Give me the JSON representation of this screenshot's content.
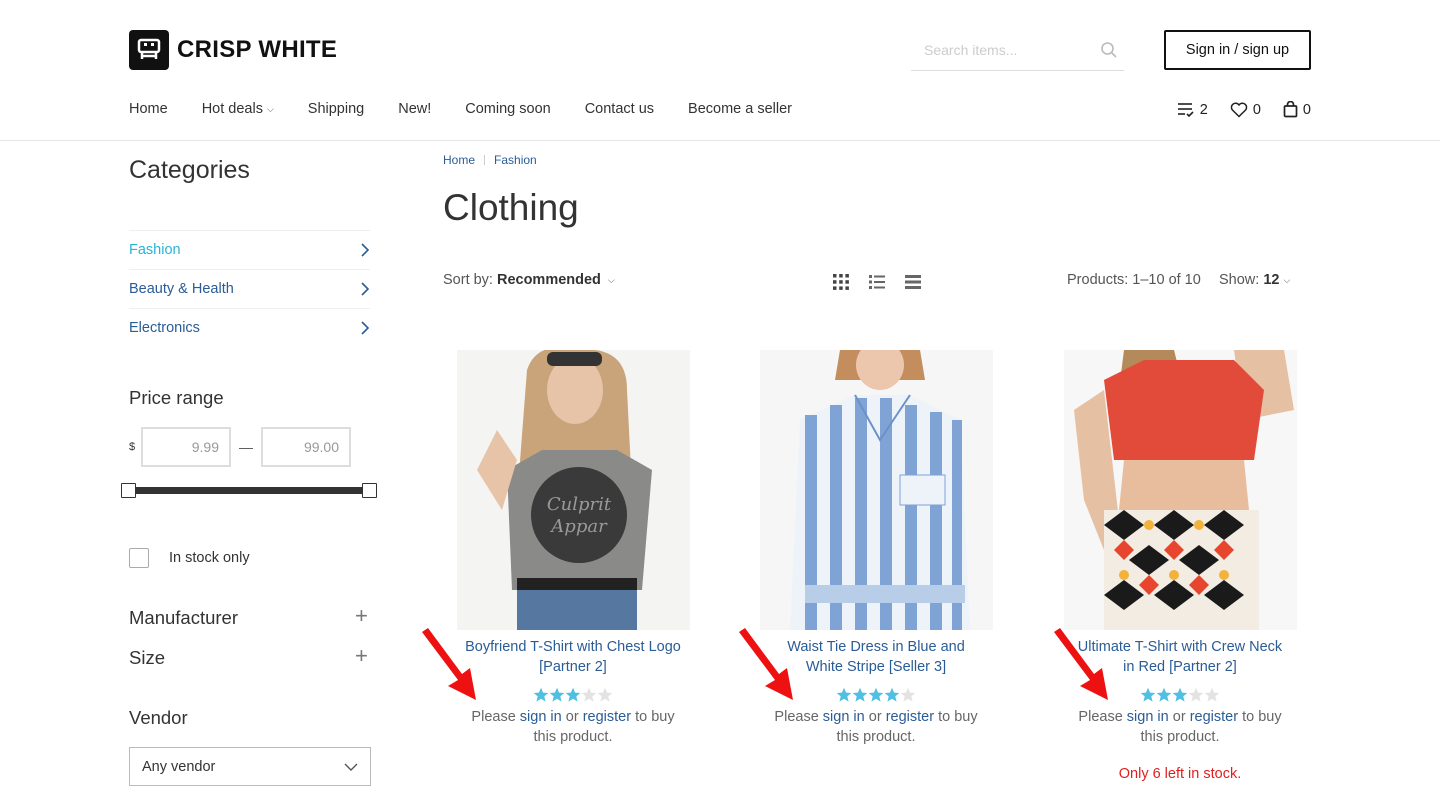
{
  "header": {
    "brand": "CRISP WHITE",
    "search_placeholder": "Search items...",
    "signin_label": "Sign in / sign up",
    "wishlist_count": "2",
    "favorites_count": "0",
    "cart_count": "0"
  },
  "nav": [
    {
      "label": "Home"
    },
    {
      "label": "Hot deals"
    },
    {
      "label": "Shipping"
    },
    {
      "label": "New!"
    },
    {
      "label": "Coming soon"
    },
    {
      "label": "Contact us"
    },
    {
      "label": "Become a seller"
    }
  ],
  "sidebar": {
    "title": "Categories",
    "categories": [
      {
        "label": "Fashion",
        "active": true
      },
      {
        "label": "Beauty & Health",
        "active": false
      },
      {
        "label": "Electronics",
        "active": false
      }
    ],
    "price_range_title": "Price range",
    "currency": "$",
    "price_min": "9.99",
    "price_max": "99.00",
    "dash": "—",
    "in_stock_label": "In stock only",
    "manufacturer_title": "Manufacturer",
    "size_title": "Size",
    "vendor_title": "Vendor",
    "vendor_selected": "Any vendor"
  },
  "breadcrumb": [
    "Home",
    "Fashion"
  ],
  "page_title": "Clothing",
  "toolbar": {
    "sort_label": "Sort by:",
    "sort_value": "Recommended",
    "products_count": "Products: 1–10 of 10",
    "show_label": "Show:",
    "show_value": "12"
  },
  "products": [
    {
      "title_line1": "Boyfriend T-Shirt with Chest Logo",
      "title_line2": "[Partner 2]",
      "rating": 3,
      "buy_pre": "Please",
      "sign_in": "sign in",
      "or": "or",
      "register": "register",
      "buy_post": "to buy",
      "buy_line2": "this product.",
      "stock_note": ""
    },
    {
      "title_line1": "Waist Tie Dress in Blue and",
      "title_line2": "White Stripe [Seller 3]",
      "rating": 4,
      "buy_pre": "Please",
      "sign_in": "sign in",
      "or": "or",
      "register": "register",
      "buy_post": "to buy",
      "buy_line2": "this product.",
      "stock_note": ""
    },
    {
      "title_line1": "Ultimate T-Shirt with Crew Neck",
      "title_line2": "in Red [Partner 2]",
      "rating": 3.5,
      "buy_pre": "Please",
      "sign_in": "sign in",
      "or": "or",
      "register": "register",
      "buy_post": "to buy",
      "buy_line2": "this product.",
      "stock_note": "Only 6 left in stock."
    }
  ],
  "colors": {
    "link": "#2a5c96",
    "active_category": "#2bb3d6",
    "star": "#4fc1e0",
    "stock_warning": "#e02020",
    "annotation_arrow": "#ee1111"
  }
}
